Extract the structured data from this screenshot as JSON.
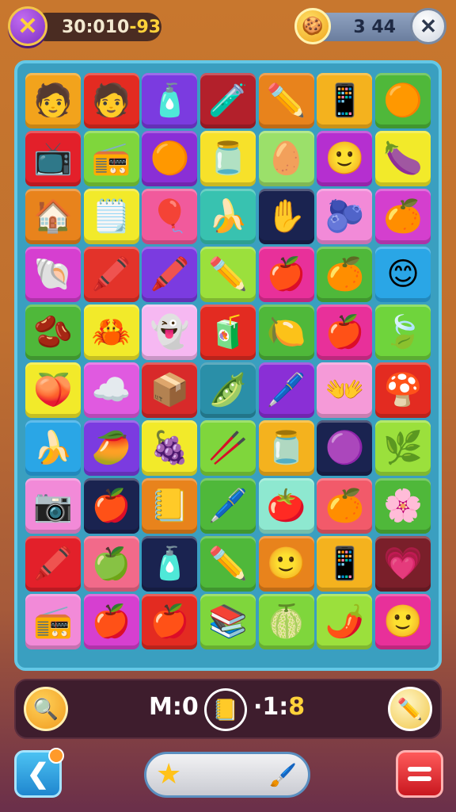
{
  "hud": {
    "timer": "30:0",
    "timer_mid": "10",
    "timer_end": "-93",
    "coins": "3 44",
    "close_icon": "x-icon",
    "coin_icon": "cookie-face-icon",
    "exit_icon": "x-icon"
  },
  "board": {
    "rows": [
      [
        {
          "icon": "face-red-hair",
          "glyph": "🧑",
          "bg": "#f2a31c"
        },
        {
          "icon": "face-green-hat",
          "glyph": "🧑",
          "bg": "#e32b21"
        },
        {
          "icon": "spray-bottle",
          "glyph": "🧴",
          "bg": "#7b3be0"
        },
        {
          "icon": "glue-stick",
          "glyph": "🧪",
          "bg": "#b3202b"
        },
        {
          "icon": "pencil",
          "glyph": "✏️",
          "bg": "#e8831c"
        },
        {
          "icon": "calculator",
          "glyph": "📱",
          "bg": "#f4b21e"
        },
        {
          "icon": "orange-face",
          "glyph": "🟠",
          "bg": "#4fb83a"
        }
      ],
      [
        {
          "icon": "tv",
          "glyph": "📺",
          "bg": "#e3202a"
        },
        {
          "icon": "radio",
          "glyph": "📻",
          "bg": "#7fd63c"
        },
        {
          "icon": "orange-face",
          "glyph": "🟠",
          "bg": "#8a2fd6"
        },
        {
          "icon": "jar-face",
          "glyph": "🫙",
          "bg": "#f7e12a"
        },
        {
          "icon": "green-leaf",
          "glyph": "🥚",
          "bg": "#9be06a"
        },
        {
          "icon": "face",
          "glyph": "🙂",
          "bg": "#b52fd0"
        },
        {
          "icon": "eggplant",
          "glyph": "🍆",
          "bg": "#f2ea2a"
        }
      ],
      [
        {
          "icon": "house",
          "glyph": "🏠",
          "bg": "#e8831c"
        },
        {
          "icon": "note-pencil",
          "glyph": "🗒️",
          "bg": "#f2ea2a"
        },
        {
          "icon": "balloon",
          "glyph": "🎈",
          "bg": "#f15a9c"
        },
        {
          "icon": "bananas",
          "glyph": "🍌",
          "bg": "#38c2b0"
        },
        {
          "icon": "hand",
          "glyph": "✋",
          "bg": "#1a2350"
        },
        {
          "icon": "blue-fruit",
          "glyph": "🫐",
          "bg": "#f28ad8"
        },
        {
          "icon": "orange",
          "glyph": "🍊",
          "bg": "#d43fce"
        }
      ],
      [
        {
          "icon": "shell",
          "glyph": "🐚",
          "bg": "#d63fd0"
        },
        {
          "icon": "crayon",
          "glyph": "🖍️",
          "bg": "#e3332a"
        },
        {
          "icon": "crayon",
          "glyph": "🖍️",
          "bg": "#7b3be0"
        },
        {
          "icon": "pencil",
          "glyph": "✏️",
          "bg": "#9be03c"
        },
        {
          "icon": "apple",
          "glyph": "🍎",
          "bg": "#e8309a"
        },
        {
          "icon": "orange-apple",
          "glyph": "🍊",
          "bg": "#4fb83a"
        },
        {
          "icon": "smiley",
          "glyph": "😊",
          "bg": "#2aa6e6"
        }
      ],
      [
        {
          "icon": "red-bean",
          "glyph": "🫘",
          "bg": "#4fb83a"
        },
        {
          "icon": "red-blob",
          "glyph": "🦀",
          "bg": "#f2ea2a"
        },
        {
          "icon": "ghost",
          "glyph": "👻",
          "bg": "#f6b8f2"
        },
        {
          "icon": "glue",
          "glyph": "🧃",
          "bg": "#e32b21"
        },
        {
          "icon": "lemon",
          "glyph": "🍋",
          "bg": "#4fb83a"
        },
        {
          "icon": "apple",
          "glyph": "🍎",
          "bg": "#e8309a"
        },
        {
          "icon": "leaf",
          "glyph": "🍃",
          "bg": "#6fd43c"
        }
      ],
      [
        {
          "icon": "peach",
          "glyph": "🍑",
          "bg": "#f2ea2a"
        },
        {
          "icon": "cloud-face",
          "glyph": "☁️",
          "bg": "#e05ae0"
        },
        {
          "icon": "box",
          "glyph": "📦",
          "bg": "#d82a2a"
        },
        {
          "icon": "green-blob",
          "glyph": "🫛",
          "bg": "#2a8fa8"
        },
        {
          "icon": "pen",
          "glyph": "🖊️",
          "bg": "#8a2fd6"
        },
        {
          "icon": "hands",
          "glyph": "👐",
          "bg": "#f59ad8"
        },
        {
          "icon": "mushroom",
          "glyph": "🍄",
          "bg": "#e32b21"
        }
      ],
      [
        {
          "icon": "banana",
          "glyph": "🍌",
          "bg": "#2aa6e6"
        },
        {
          "icon": "mango",
          "glyph": "🥭",
          "bg": "#7b3be0"
        },
        {
          "icon": "plum",
          "glyph": "🍇",
          "bg": "#f2ea2a"
        },
        {
          "icon": "stick",
          "glyph": "🥢",
          "bg": "#7fd63c"
        },
        {
          "icon": "jar",
          "glyph": "🫙",
          "bg": "#f4b21e"
        },
        {
          "icon": "purple-face",
          "glyph": "🟣",
          "bg": "#1a2350"
        },
        {
          "icon": "plant",
          "glyph": "🌿",
          "bg": "#9be03c"
        }
      ],
      [
        {
          "icon": "camera",
          "glyph": "📷",
          "bg": "#f28ad8"
        },
        {
          "icon": "apple",
          "glyph": "🍎",
          "bg": "#1a2350"
        },
        {
          "icon": "book",
          "glyph": "📒",
          "bg": "#e8831c"
        },
        {
          "icon": "marker",
          "glyph": "🖊️",
          "bg": "#4fb83a"
        },
        {
          "icon": "tomato",
          "glyph": "🍅",
          "bg": "#8ee8d0"
        },
        {
          "icon": "orange",
          "glyph": "🍊",
          "bg": "#f25a6a"
        },
        {
          "icon": "flower",
          "glyph": "🌸",
          "bg": "#4fb83a"
        }
      ],
      [
        {
          "icon": "marker",
          "glyph": "🖍️",
          "bg": "#e3202a"
        },
        {
          "icon": "green-apple",
          "glyph": "🍏",
          "bg": "#f26a8a"
        },
        {
          "icon": "bottle",
          "glyph": "🧴",
          "bg": "#1a2350"
        },
        {
          "icon": "pencil",
          "glyph": "✏️",
          "bg": "#4fb83a"
        },
        {
          "icon": "face",
          "glyph": "🙂",
          "bg": "#e8831c"
        },
        {
          "icon": "tablet",
          "glyph": "📱",
          "bg": "#f4b21e"
        },
        {
          "icon": "heart",
          "glyph": "💗",
          "bg": "#7a1f2a"
        }
      ],
      [
        {
          "icon": "radio",
          "glyph": "📻",
          "bg": "#f28ad8"
        },
        {
          "icon": "apple",
          "glyph": "🍎",
          "bg": "#d63fd0"
        },
        {
          "icon": "apple",
          "glyph": "🍎",
          "bg": "#e32b21"
        },
        {
          "icon": "book",
          "glyph": "📚",
          "bg": "#7fd63c"
        },
        {
          "icon": "leaf-ball",
          "glyph": "🍈",
          "bg": "#7fd63c"
        },
        {
          "icon": "chili",
          "glyph": "🌶️",
          "bg": "#9be03c"
        },
        {
          "icon": "face",
          "glyph": "🙂",
          "bg": "#e8309a"
        }
      ]
    ]
  },
  "bottom": {
    "moves_label": "M:0",
    "level_sep": "·1:",
    "level_num": "8",
    "search_icon": "magnifier-icon",
    "center_icon": "pencil-box-icon",
    "pencil_icon": "pencil-icon",
    "back_icon": "back-arrow-icon",
    "star_icon": "star-icon",
    "pen_icon": "pen-icon",
    "menu_icon": "menu-icon"
  }
}
